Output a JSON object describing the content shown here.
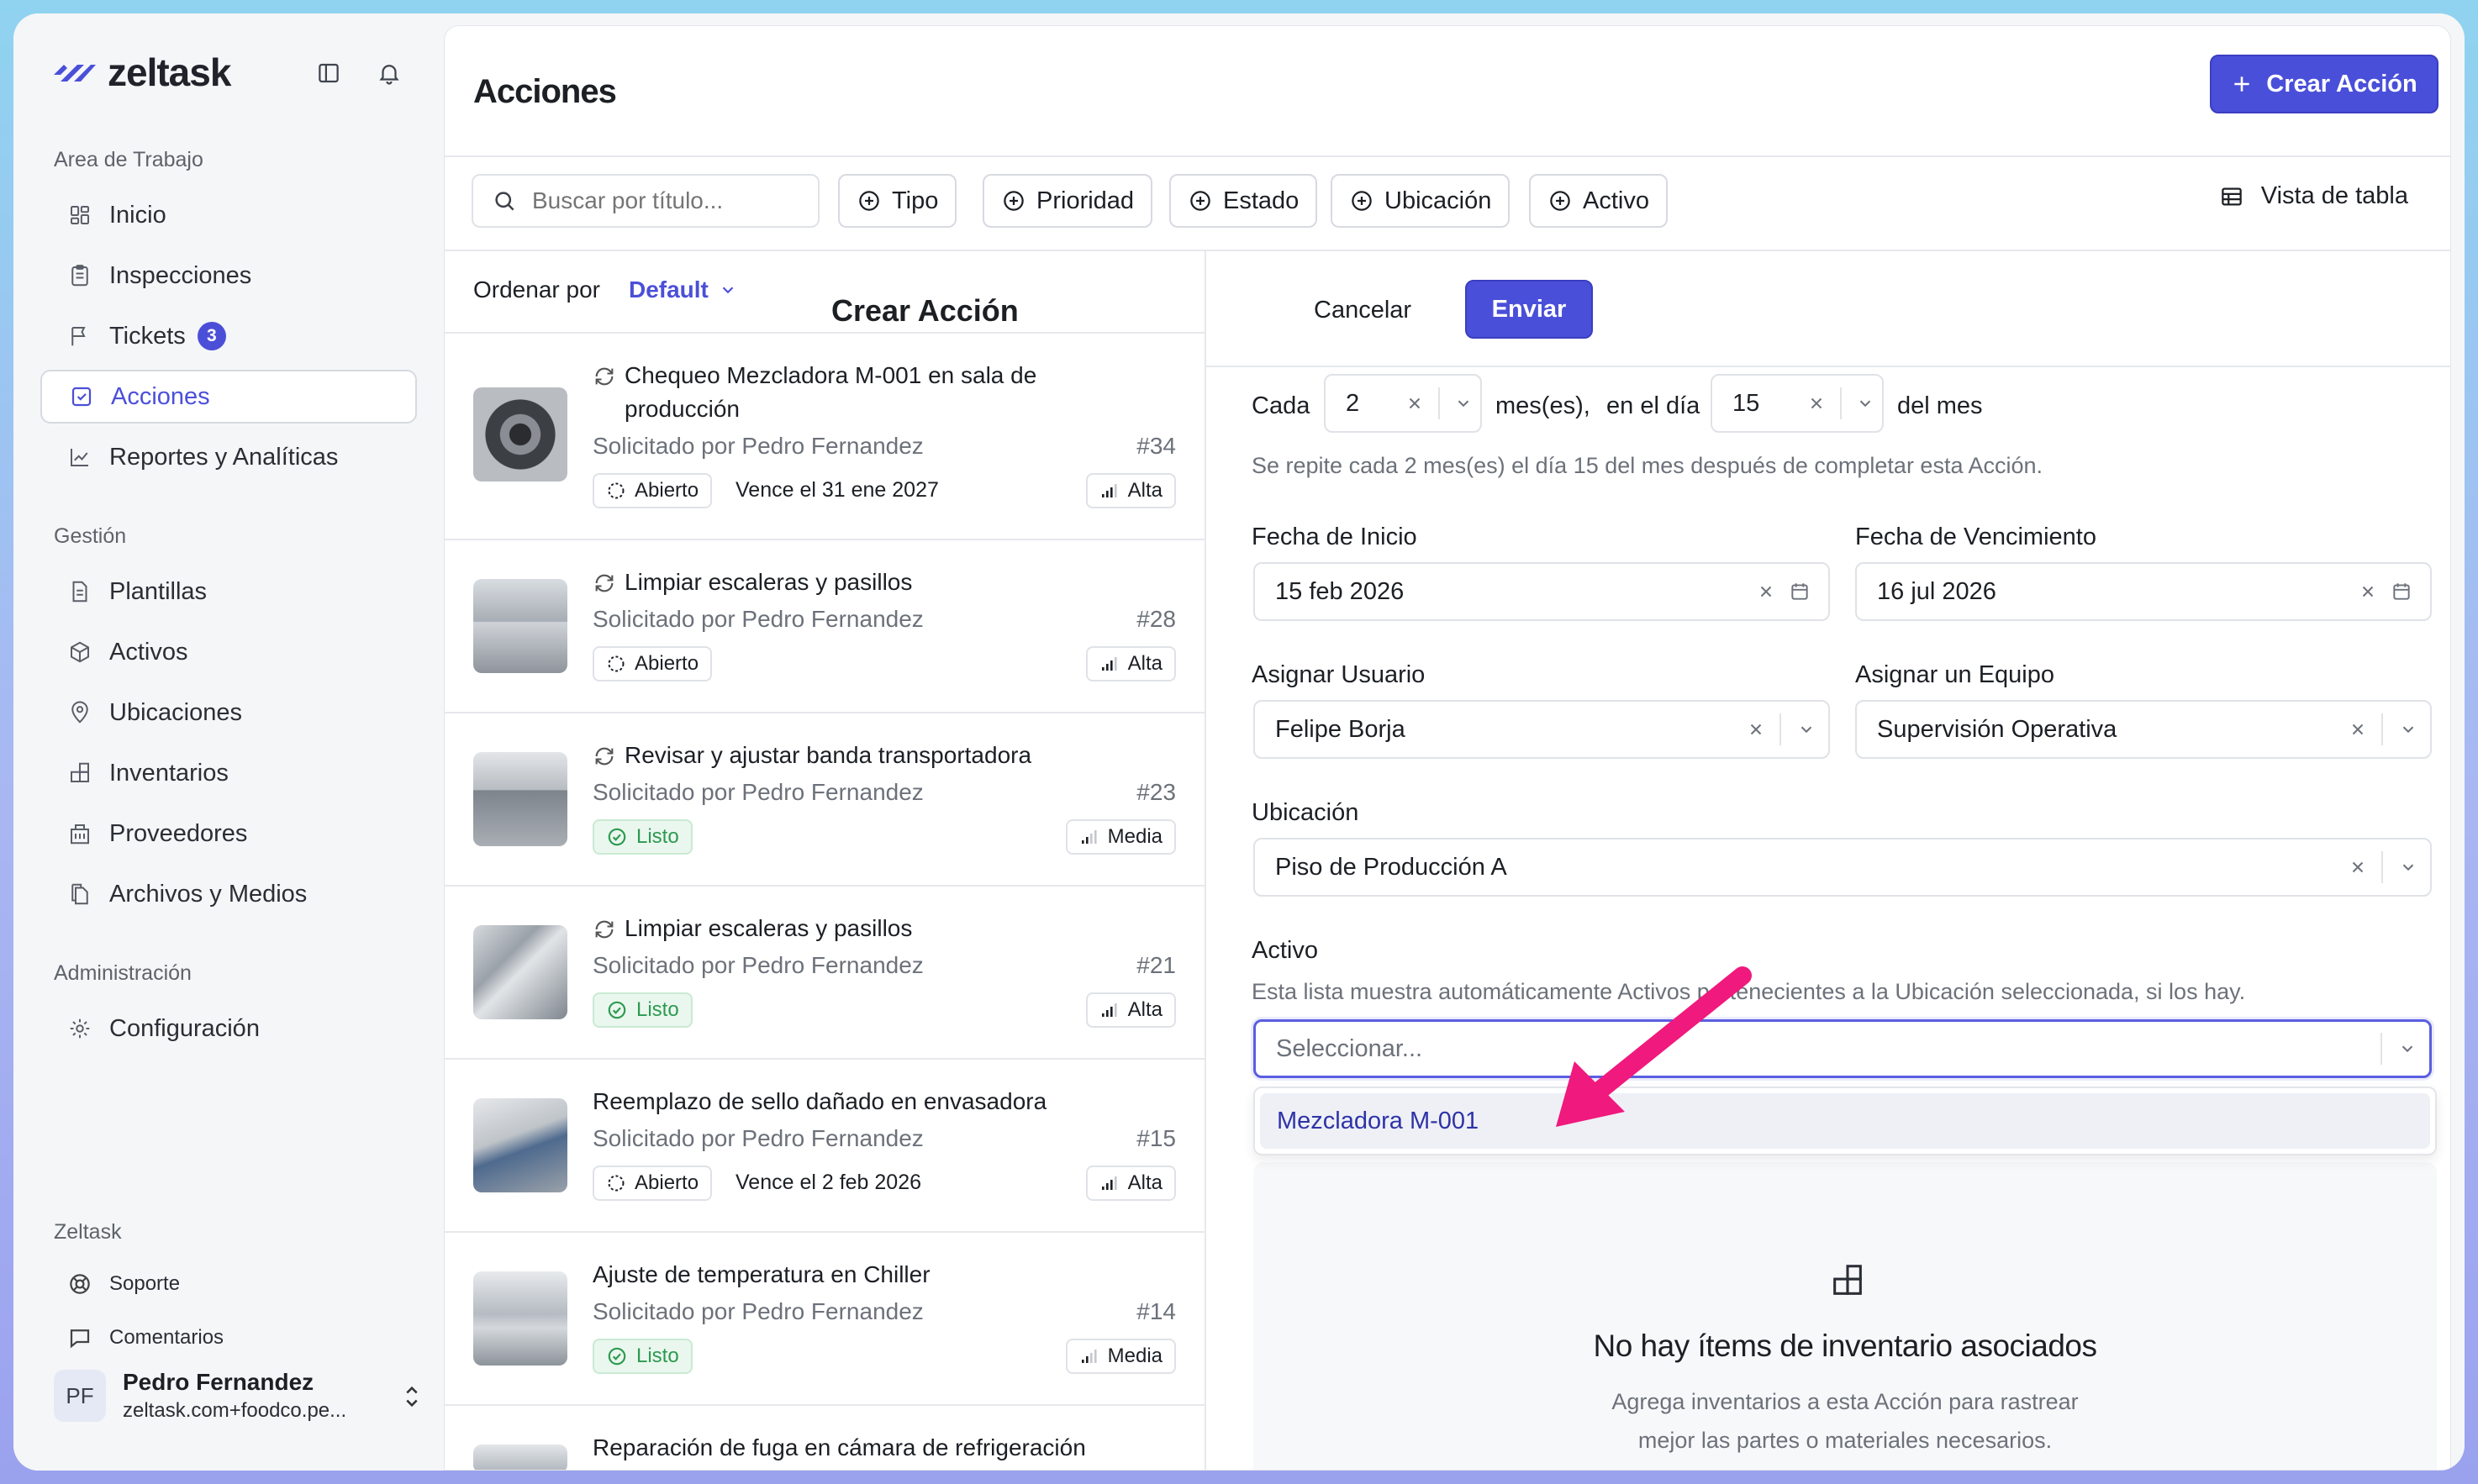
{
  "brand": {
    "name": "zeltask"
  },
  "sidebar": {
    "workspace_title": "Area de Trabajo",
    "workspace_items": [
      {
        "label": "Inicio",
        "icon": "grid-icon"
      },
      {
        "label": "Inspecciones",
        "icon": "clipboard-icon"
      },
      {
        "label": "Tickets",
        "icon": "flag-icon",
        "badge": "3"
      },
      {
        "label": "Acciones",
        "icon": "check-square-icon",
        "active": true
      },
      {
        "label": "Reportes y Analíticas",
        "icon": "chart-line-icon"
      }
    ],
    "management_title": "Gestión",
    "management_items": [
      {
        "label": "Plantillas",
        "icon": "document-icon"
      },
      {
        "label": "Activos",
        "icon": "cube-icon"
      },
      {
        "label": "Ubicaciones",
        "icon": "map-pin-icon"
      },
      {
        "label": "Inventarios",
        "icon": "boxes-icon"
      },
      {
        "label": "Proveedores",
        "icon": "building-icon"
      },
      {
        "label": "Archivos y Medios",
        "icon": "files-icon"
      }
    ],
    "admin_title": "Administración",
    "admin_items": [
      {
        "label": "Configuración",
        "icon": "gear-icon"
      }
    ],
    "footer_title": "Zeltask",
    "footer_items": [
      {
        "label": "Soporte",
        "icon": "lifebuoy-icon"
      },
      {
        "label": "Comentarios",
        "icon": "comment-icon"
      }
    ],
    "user": {
      "initials": "PF",
      "name": "Pedro Fernandez",
      "email": "zeltask.com+foodco.pe..."
    }
  },
  "header": {
    "title": "Acciones",
    "create_label": "Crear Acción"
  },
  "filters": {
    "search_placeholder": "Buscar por título...",
    "buttons": [
      "Tipo",
      "Prioridad",
      "Estado",
      "Ubicación",
      "Activo"
    ],
    "view_label": "Vista de tabla"
  },
  "list": {
    "sort_label": "Ordenar por",
    "sort_value": "Default",
    "requested_prefix": "Solicitado por Pedro Fernandez",
    "items": [
      {
        "title": "Chequeo Mezcladora M-001 en sala de producción",
        "repeat": true,
        "requested_by": "Solicitado por Pedro Fernandez",
        "number": "#34",
        "status": "Abierto",
        "due": "Vence el 31 ene 2027",
        "priority": "Alta"
      },
      {
        "title": "Limpiar escaleras y pasillos",
        "repeat": true,
        "requested_by": "Solicitado por Pedro Fernandez",
        "number": "#28",
        "status": "Abierto",
        "due": "",
        "priority": "Alta"
      },
      {
        "title": "Revisar y ajustar banda transportadora",
        "repeat": true,
        "requested_by": "Solicitado por Pedro Fernandez",
        "number": "#23",
        "status": "Listo",
        "due": "",
        "priority": "Media"
      },
      {
        "title": "Limpiar escaleras y pasillos",
        "repeat": true,
        "requested_by": "Solicitado por Pedro Fernandez",
        "number": "#21",
        "status": "Listo",
        "due": "",
        "priority": "Alta"
      },
      {
        "title": "Reemplazo de sello dañado en envasadora",
        "repeat": false,
        "requested_by": "Solicitado por Pedro Fernandez",
        "number": "#15",
        "status": "Abierto",
        "due": "Vence el 2 feb 2026",
        "priority": "Alta"
      },
      {
        "title": "Ajuste de temperatura en Chiller",
        "repeat": false,
        "requested_by": "Solicitado por Pedro Fernandez",
        "number": "#14",
        "status": "Listo",
        "due": "",
        "priority": "Media"
      },
      {
        "title": "Reparación de fuga en cámara de refrigeración",
        "repeat": false,
        "requested_by": "",
        "number": "",
        "status": "",
        "due": "",
        "priority": ""
      }
    ]
  },
  "form": {
    "title": "Crear Acción",
    "cancel_label": "Cancelar",
    "submit_label": "Enviar",
    "recurrence": {
      "every_label": "Cada",
      "every_value": "2",
      "unit_label": "mes(es),",
      "day_label": "en el día",
      "day_value": "15",
      "suffix_label": "del mes",
      "help": "Se repite cada 2 mes(es) el día 15 del mes después de completar esta Acción."
    },
    "start_date_label": "Fecha de Inicio",
    "start_date_value": "15 feb 2026",
    "due_date_label": "Fecha de Vencimiento",
    "due_date_value": "16 jul 2026",
    "assign_user_label": "Asignar Usuario",
    "assign_user_value": "Felipe Borja",
    "assign_team_label": "Asignar un Equipo",
    "assign_team_value": "Supervisión Operativa",
    "location_label": "Ubicación",
    "location_value": "Piso de Producción A",
    "asset_label": "Activo",
    "asset_help": "Esta lista muestra automáticamente Activos pertenecientes a la Ubicación seleccionada, si los hay.",
    "asset_placeholder": "Seleccionar...",
    "asset_options": [
      "Mezcladora M-001"
    ],
    "inventory_empty_title": "No hay ítems de inventario asociados",
    "inventory_empty_desc_1": "Agrega inventarios a esta Acción para rastrear",
    "inventory_empty_desc_2": "mejor las partes o materiales necesarios."
  },
  "colors": {
    "accent": "#4a4fd9",
    "annotation_arrow": "#f0197d",
    "done_green": "#2c9a4f"
  }
}
